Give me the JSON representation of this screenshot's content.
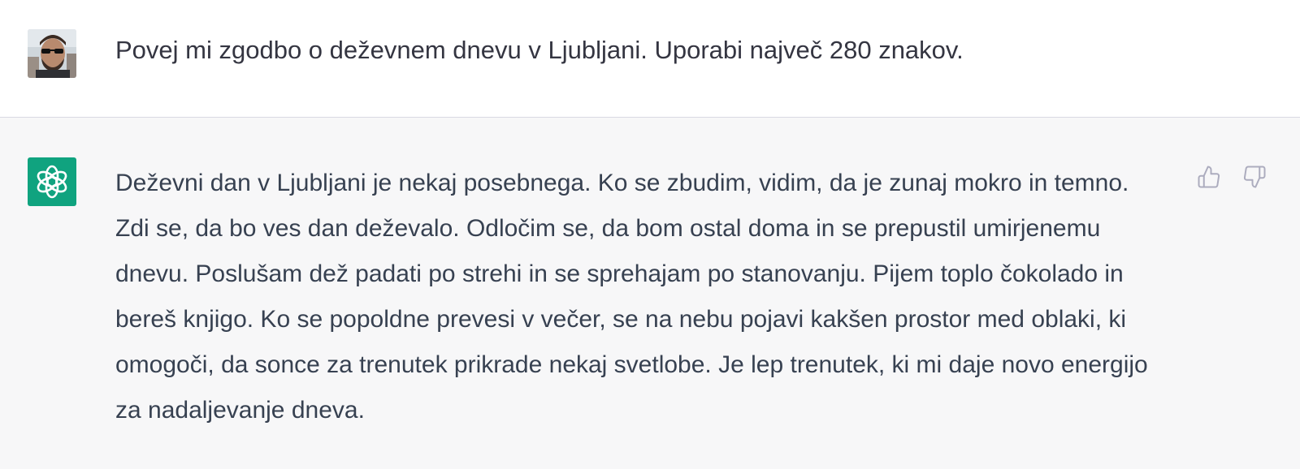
{
  "conversation": {
    "user_message": "Povej mi zgodbo o deževnem dnevu v Ljubljani. Uporabi največ 280 znakov.",
    "assistant_message": "Deževni dan v Ljubljani je nekaj posebnega. Ko se zbudim, vidim, da je zunaj mokro in temno. Zdi se, da bo ves dan deževalo. Odločim se, da bom ostal doma in se prepustil umirjenemu dnevu. Poslušam dež padati po strehi in se sprehajam po stanovanju. Pijem toplo čokolado in bereš knjigo. Ko se popoldne prevesi v večer, se na nebu pojavi kakšen prostor med oblaki, ki omogoči, da sonce za trenutek prikrade nekaj svetlobe. Je lep trenutek, ki mi daje novo energijo za nadaljevanje dneva."
  },
  "icons": {
    "user_avatar": "user-avatar-photo",
    "assistant_avatar": "openai-logo-icon",
    "thumbs_up": "thumbs-up-icon",
    "thumbs_down": "thumbs-down-icon"
  },
  "colors": {
    "assistant_brand": "#10a37f",
    "assistant_background": "#f7f7f8",
    "text": "#374151",
    "icon": "#acacbe"
  }
}
